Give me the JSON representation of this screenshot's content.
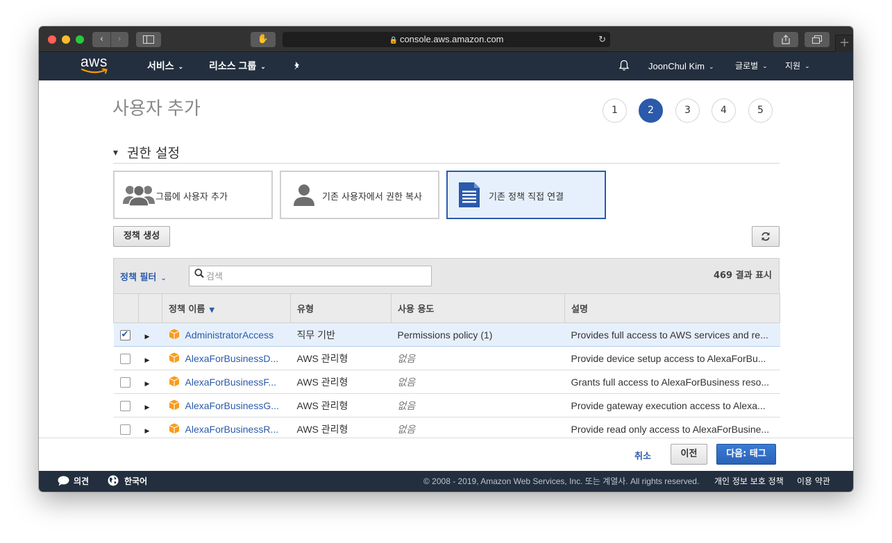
{
  "browser": {
    "url": "console.aws.amazon.com"
  },
  "nav": {
    "logo": "aws",
    "services": "서비스",
    "resource_groups": "리소스 그룹",
    "user": "JoonChul Kim",
    "region": "글로벌",
    "support": "지원"
  },
  "page": {
    "title": "사용자 추가",
    "steps": [
      "1",
      "2",
      "3",
      "4",
      "5"
    ],
    "active_step": 2,
    "section_title": "권한 설정"
  },
  "options": [
    {
      "label": "그룹에 사용자 추가",
      "icon": "group-icon",
      "selected": false
    },
    {
      "label": "기존 사용자에서 권한 복사",
      "icon": "user-icon",
      "selected": false
    },
    {
      "label": "기존 정책 직접 연결",
      "icon": "document-icon",
      "selected": true
    }
  ],
  "toolbar": {
    "create_policy": "정책 생성",
    "refresh_icon": "refresh-icon"
  },
  "filter": {
    "label": "정책 필터",
    "search_placeholder": "검색",
    "result_count": "469 결과 표시"
  },
  "table": {
    "columns": [
      "정책 이름",
      "유형",
      "사용 용도",
      "설명"
    ],
    "rows": [
      {
        "checked": true,
        "name": "AdministratorAccess",
        "type": "직무 기반",
        "usage": "Permissions policy (1)",
        "usage_none": false,
        "description": "Provides full access to AWS services and re..."
      },
      {
        "checked": false,
        "name": "AlexaForBusinessD...",
        "type": "AWS 관리형",
        "usage": "없음",
        "usage_none": true,
        "description": "Provide device setup access to AlexaForBu..."
      },
      {
        "checked": false,
        "name": "AlexaForBusinessF...",
        "type": "AWS 관리형",
        "usage": "없음",
        "usage_none": true,
        "description": "Grants full access to AlexaForBusiness reso..."
      },
      {
        "checked": false,
        "name": "AlexaForBusinessG...",
        "type": "AWS 관리형",
        "usage": "없음",
        "usage_none": true,
        "description": "Provide gateway execution access to Alexa..."
      },
      {
        "checked": false,
        "name": "AlexaForBusinessR...",
        "type": "AWS 관리형",
        "usage": "없음",
        "usage_none": true,
        "description": "Provide read only access to AlexaForBusine..."
      }
    ]
  },
  "actions": {
    "cancel": "취소",
    "previous": "이전",
    "next": "다음: 태그"
  },
  "footer": {
    "feedback": "의견",
    "language": "한국어",
    "copyright": "© 2008 - 2019, Amazon Web Services, Inc. 또는 계열사. All rights reserved.",
    "privacy": "개인 정보 보호 정책",
    "terms": "이용 약관"
  },
  "colors": {
    "aws_nav": "#232f3e",
    "accent_blue": "#2b5aab",
    "selected_row": "#e6f0fc",
    "aws_orange": "#ff9900"
  }
}
